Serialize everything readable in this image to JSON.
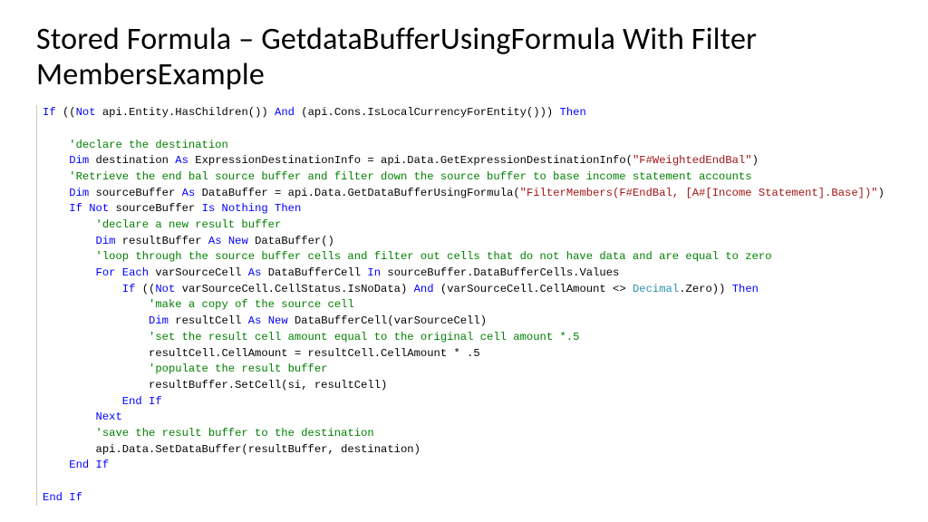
{
  "title": "Stored Formula – GetdataBufferUsingFormula With Filter MembersExample",
  "code": {
    "l1": {
      "a": "If",
      "b": " ((",
      "c": "Not",
      "d": " api.Entity.HasChildren()) ",
      "e": "And",
      "f": " (api.Cons.IsLocalCurrencyForEntity())) ",
      "g": "Then"
    },
    "l2": "",
    "l3": {
      "a": "    ",
      "b": "'declare the destination"
    },
    "l4": {
      "a": "    ",
      "b": "Dim",
      "c": " destination ",
      "d": "As",
      "e": " ExpressionDestinationInfo = api.Data.GetExpressionDestinationInfo(",
      "f": "\"F#WeightedEndBal\"",
      "g": ")"
    },
    "l5": {
      "a": "    ",
      "b": "'Retrieve the end bal source buffer and filter down the source buffer to base income statement accounts"
    },
    "l6": {
      "a": "    ",
      "b": "Dim",
      "c": " sourceBuffer ",
      "d": "As",
      "e": " DataBuffer = api.Data.GetDataBufferUsingFormula(",
      "f": "\"FilterMembers(F#EndBal, [A#[Income Statement].Base])\"",
      "g": ")"
    },
    "l7": {
      "a": "    ",
      "b": "If Not",
      "c": " sourceBuffer ",
      "d": "Is Nothing Then"
    },
    "l8": {
      "a": "        ",
      "b": "'declare a new result buffer"
    },
    "l9": {
      "a": "        ",
      "b": "Dim",
      "c": " resultBuffer ",
      "d": "As New",
      "e": " DataBuffer()"
    },
    "l10": {
      "a": "        ",
      "b": "'loop through the source buffer cells and filter out cells that do not have data and are equal to zero"
    },
    "l11": {
      "a": "        ",
      "b": "For Each",
      "c": " varSourceCell ",
      "d": "As",
      "e": " DataBufferCell ",
      "f": "In",
      "g": " sourceBuffer.DataBufferCells.Values"
    },
    "l12": {
      "a": "            ",
      "b": "If",
      "c": " ((",
      "d": "Not",
      "e": " varSourceCell.CellStatus.IsNoData) ",
      "f": "And",
      "g": " (varSourceCell.CellAmount <> ",
      "h": "Decimal",
      "i": ".Zero)) ",
      "j": "Then"
    },
    "l13": {
      "a": "                ",
      "b": "'make a copy of the source cell"
    },
    "l14": {
      "a": "                ",
      "b": "Dim",
      "c": " resultCell ",
      "d": "As New",
      "e": " DataBufferCell(varSourceCell)"
    },
    "l15": {
      "a": "                ",
      "b": "'set the result cell amount equal to the original cell amount *.5"
    },
    "l16": {
      "a": "                ",
      "b": "resultCell.CellAmount = resultCell.CellAmount * .5"
    },
    "l17": {
      "a": "                ",
      "b": "'populate the result buffer"
    },
    "l18": {
      "a": "                ",
      "b": "resultBuffer.SetCell(si, resultCell)"
    },
    "l19": {
      "a": "            ",
      "b": "End If"
    },
    "l20": {
      "a": "        ",
      "b": "Next"
    },
    "l21": {
      "a": "        ",
      "b": "'save the result buffer to the destination"
    },
    "l22": {
      "a": "        ",
      "b": "api.Data.SetDataBuffer(resultBuffer, destination)"
    },
    "l23": {
      "a": "    ",
      "b": "End If"
    },
    "l24": "",
    "l25": {
      "a": "End If"
    }
  }
}
